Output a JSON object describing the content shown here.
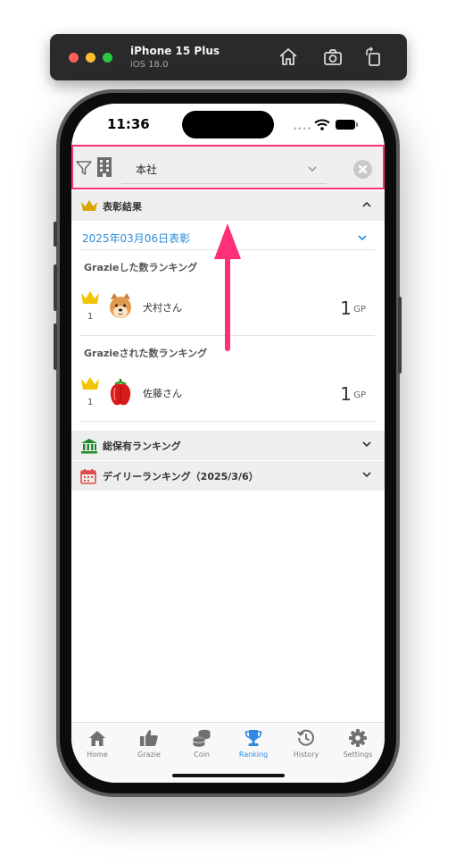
{
  "simulator": {
    "device_name": "iPhone 15 Plus",
    "os_version": "iOS 18.0"
  },
  "status_bar": {
    "time": "11:36"
  },
  "filter": {
    "office_value": "本社"
  },
  "award_section": {
    "title": "表彰結果",
    "date_label": "2025年03月06日表彰",
    "rankings": [
      {
        "title": "Grazieした数ランキング",
        "entries": [
          {
            "rank": "1",
            "name": "犬村さん",
            "points": "1",
            "unit": "GP"
          }
        ]
      },
      {
        "title": "Grazieされた数ランキング",
        "entries": [
          {
            "rank": "1",
            "name": "佐藤さん",
            "points": "1",
            "unit": "GP"
          }
        ]
      }
    ]
  },
  "collapsed_sections": [
    {
      "title": "総保有ランキング",
      "icon": "bank-icon"
    },
    {
      "title": "デイリーランキング（2025/3/6）",
      "icon": "calendar-icon"
    }
  ],
  "tabs": [
    {
      "label": "Home",
      "icon": "home-icon",
      "active": false
    },
    {
      "label": "Grazie",
      "icon": "thumbs-up-icon",
      "active": false
    },
    {
      "label": "Coin",
      "icon": "coins-icon",
      "active": false
    },
    {
      "label": "Ranking",
      "icon": "trophy-icon",
      "active": true
    },
    {
      "label": "History",
      "icon": "history-icon",
      "active": false
    },
    {
      "label": "Settings",
      "icon": "gear-icon",
      "active": false
    }
  ],
  "colors": {
    "accent": "#2d89e5",
    "highlight": "#ff2f79",
    "crown": "#f2c300",
    "bank": "#1f8a2b",
    "calendar": "#e14b4b"
  }
}
